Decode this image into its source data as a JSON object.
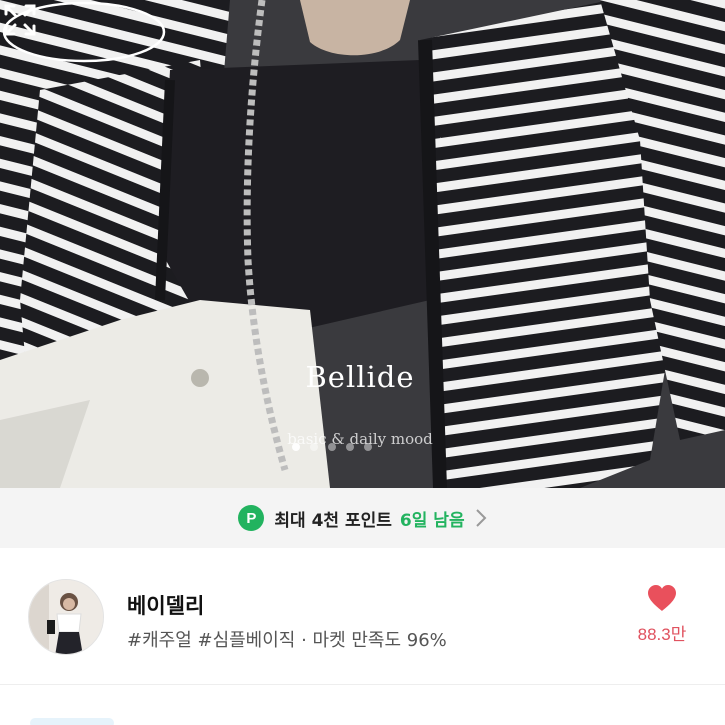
{
  "hero": {
    "brand_name": "Bellide",
    "brand_tagline": "basic & daily mood",
    "slide_count": 5,
    "active_slide": 1,
    "expand_icon": "expand-icon"
  },
  "points": {
    "badge": "P",
    "text": "최대 4천 포인트",
    "days": "6일 남음",
    "chevron_icon": "chevron-right-icon",
    "accent": "#22b35f"
  },
  "shop": {
    "name": "베이델리",
    "tags": "#캐주얼 #심플베이직 · 마켓 만족도 96%",
    "likes": "88.3만",
    "heart_color": "#e9505c"
  }
}
